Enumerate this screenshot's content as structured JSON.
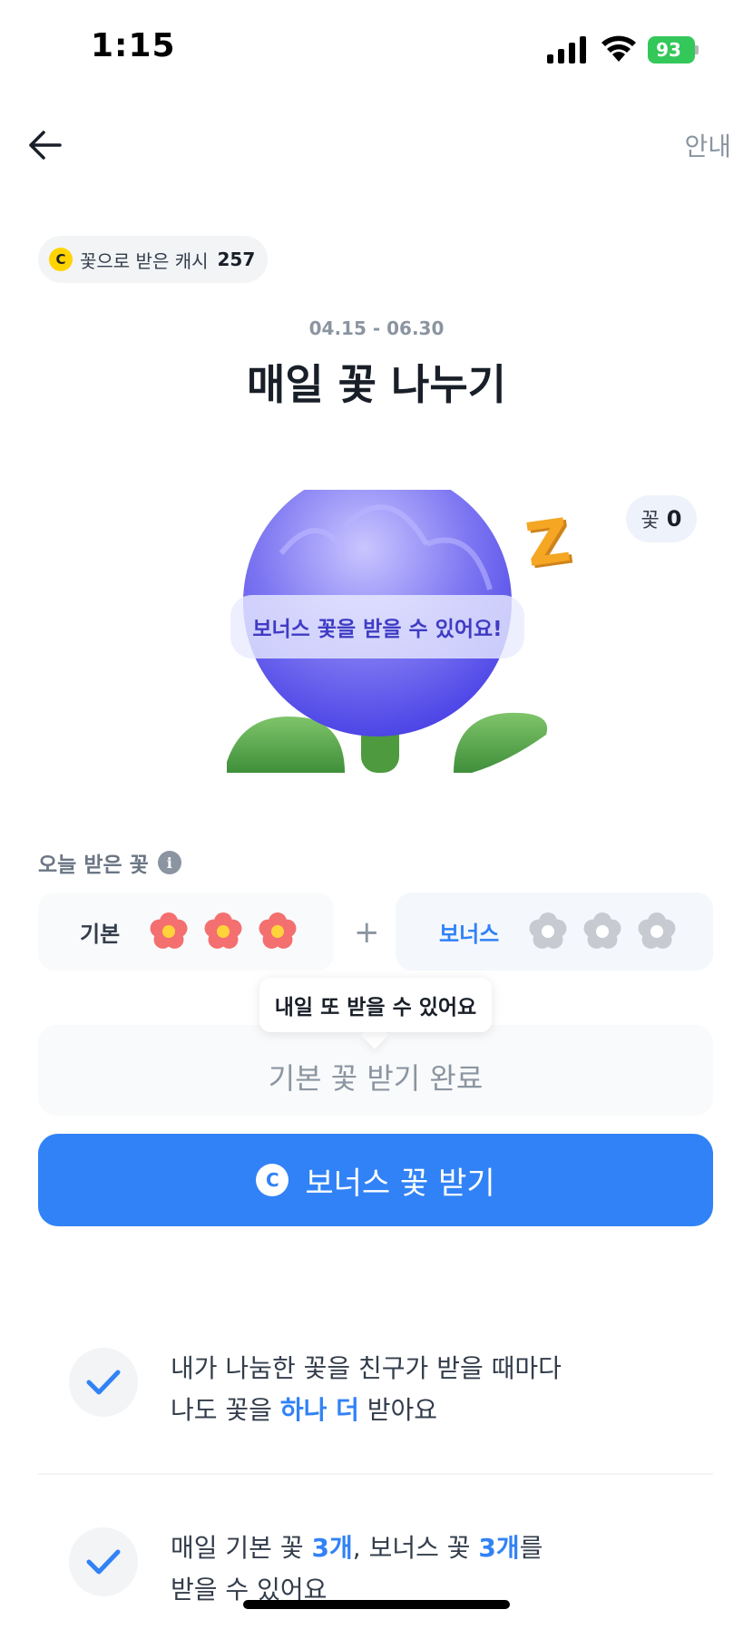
{
  "status_bar": {
    "time": "1:15",
    "battery": "93"
  },
  "nav": {
    "back_icon": "arrow-left-icon",
    "guide_label": "안내"
  },
  "cash": {
    "coin_symbol": "C",
    "label": "꽃으로 받은 캐시",
    "value": "257"
  },
  "event": {
    "period": "04.15 - 06.30",
    "title": "매일 꽃 나누기"
  },
  "flower": {
    "sleep_text": "Z",
    "count_label": "꽃",
    "count_value": "0",
    "bubble_text": "보너스 꽃을 받을 수 있어요!"
  },
  "today": {
    "label": "오늘 받은 꽃",
    "info_symbol": "i",
    "basic": {
      "title": "기본",
      "received": 3,
      "total": 3
    },
    "plus": "+",
    "bonus": {
      "title": "보너스",
      "received": 0,
      "total": 3
    }
  },
  "tooltip": "내일 또 받을 수 있어요",
  "done_button": "기본 꽃 받기 완료",
  "bonus_button": {
    "coin_symbol": "C",
    "label": "보너스 꽃 받기"
  },
  "benefits": [
    {
      "line1": "내가 나눔한 꽃을 친구가 받을 때마다",
      "line2_before": "나도 꽃을 ",
      "line2_highlight": "하나 더",
      "line2_after": " 받아요"
    },
    {
      "line1_a": "매일 기본 꽃 ",
      "line1_h1": "3개",
      "line1_b": ", 보너스 꽃 ",
      "line1_h2": "3개",
      "line1_c": "를",
      "line2": "받을 수 있어요"
    }
  ],
  "colors": {
    "primary": "#3182f6",
    "flower_red": "#f46f6f",
    "flower_center": "#ffd43b",
    "flower_gray": "#c7cbd1"
  }
}
